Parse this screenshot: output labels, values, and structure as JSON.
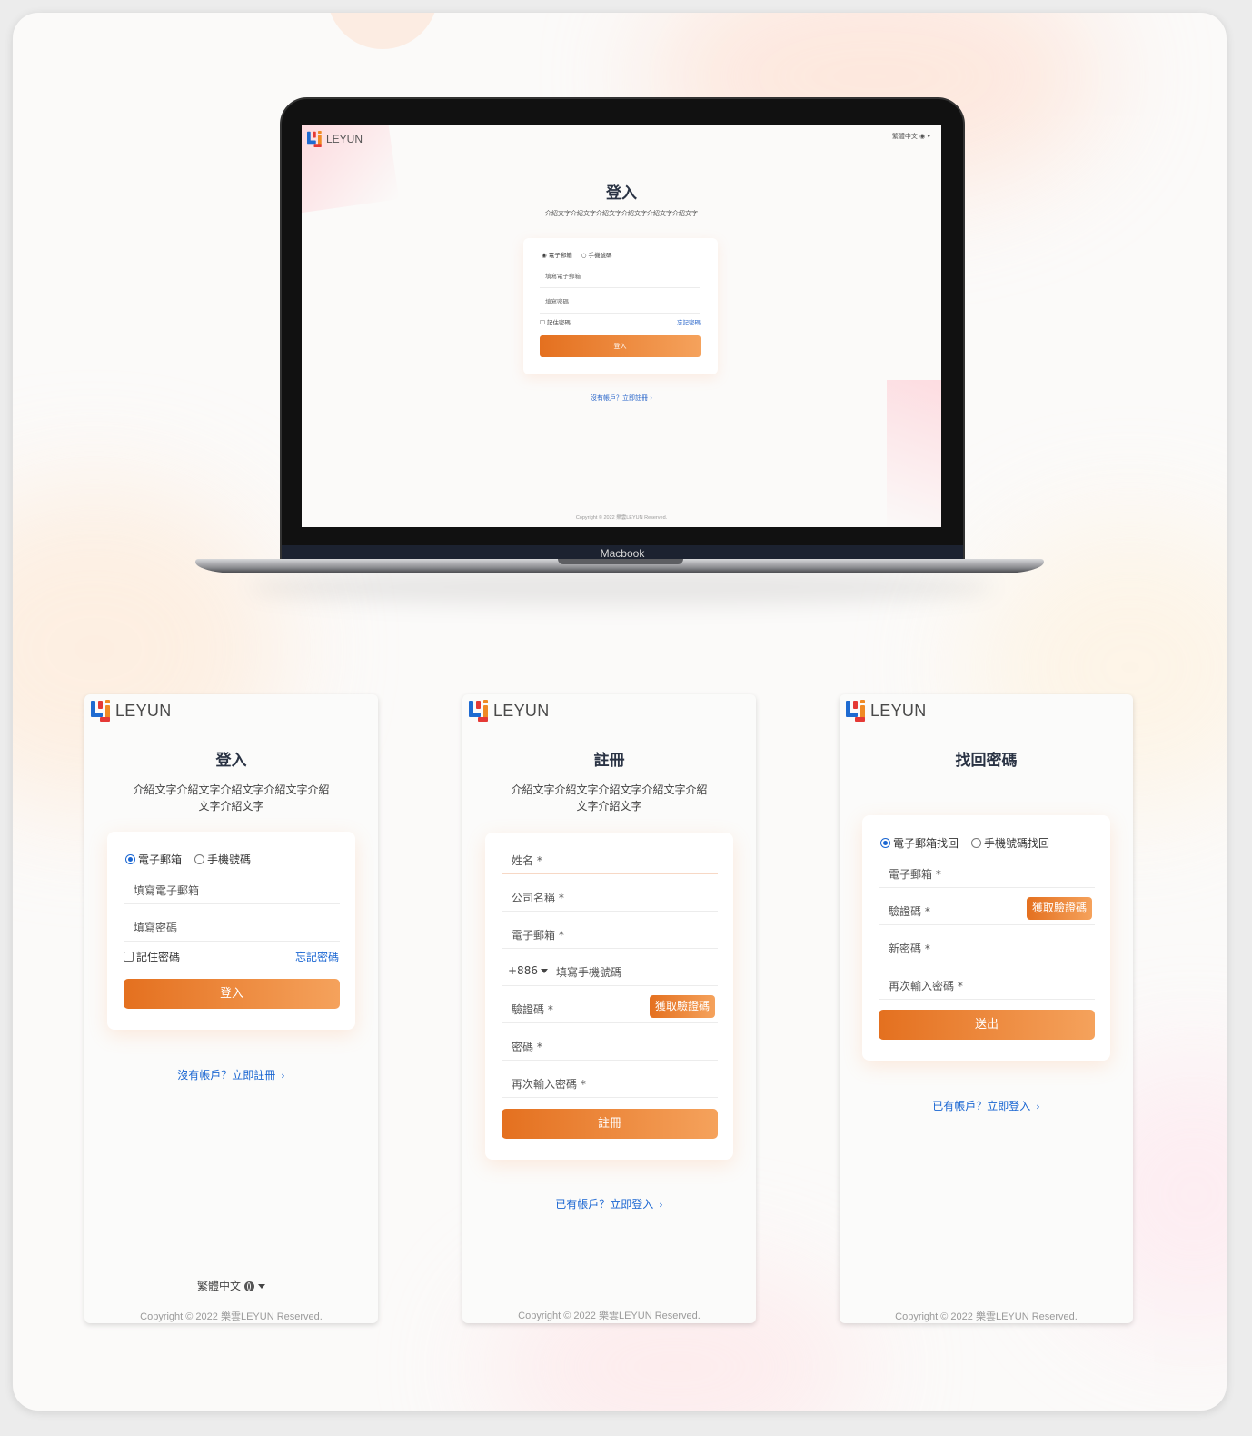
{
  "brand": {
    "name": "LEYUN"
  },
  "laptop": {
    "device_label": "Macbook",
    "language": "繁體中文",
    "title": "登入",
    "subtitle": "介紹文字介紹文字介紹文字介紹文字介紹文字介紹文字",
    "radio_email": "電子郵箱",
    "radio_phone": "手機號碼",
    "email_placeholder": "填寫電子郵箱",
    "password_placeholder": "填寫密碼",
    "remember": "記住密碼",
    "forgot": "忘記密碼",
    "submit": "登入",
    "register_link": "沒有帳戶？立即註冊",
    "copyright": "Copyright © 2022 樂雲LEYUN Reserved."
  },
  "login": {
    "title": "登入",
    "subtitle": "介紹文字介紹文字介紹文字介紹文字介紹文字介紹文字",
    "radio_email": "電子郵箱",
    "radio_phone": "手機號碼",
    "email_placeholder": "填寫電子郵箱",
    "password_placeholder": "填寫密碼",
    "remember": "記住密碼",
    "forgot": "忘記密碼",
    "submit": "登入",
    "register_link": "沒有帳戶？立即註冊",
    "language": "繁體中文",
    "copyright": "Copyright © 2022 樂雲LEYUN Reserved."
  },
  "register": {
    "title": "註冊",
    "subtitle": "介紹文字介紹文字介紹文字介紹文字介紹文字介紹文字",
    "name": "姓名 *",
    "company": "公司名稱 *",
    "email": "電子郵箱 *",
    "country_code": "+886",
    "phone_placeholder": "填寫手機號碼",
    "code": "驗證碼 *",
    "get_code": "獲取驗證碼",
    "password": "密碼 *",
    "password_confirm": "再次輸入密碼 *",
    "submit": "註冊",
    "login_link": "已有帳戶？立即登入",
    "copyright": "Copyright © 2022 樂雲LEYUN Reserved."
  },
  "recover": {
    "title": "找回密碼",
    "radio_email": "電子郵箱找回",
    "radio_phone": "手機號碼找回",
    "email": "電子郵箱 *",
    "code": "驗證碼 *",
    "get_code": "獲取驗證碼",
    "new_password": "新密碼 *",
    "password_confirm": "再次輸入密碼 *",
    "submit": "送出",
    "login_link": "已有帳戶？立即登入",
    "copyright": "Copyright © 2022 樂雲LEYUN Reserved."
  },
  "colors": {
    "accent": "#e4701f",
    "accent_end": "#f5a25c",
    "link": "#1a66d2",
    "title": "#2a3344"
  }
}
